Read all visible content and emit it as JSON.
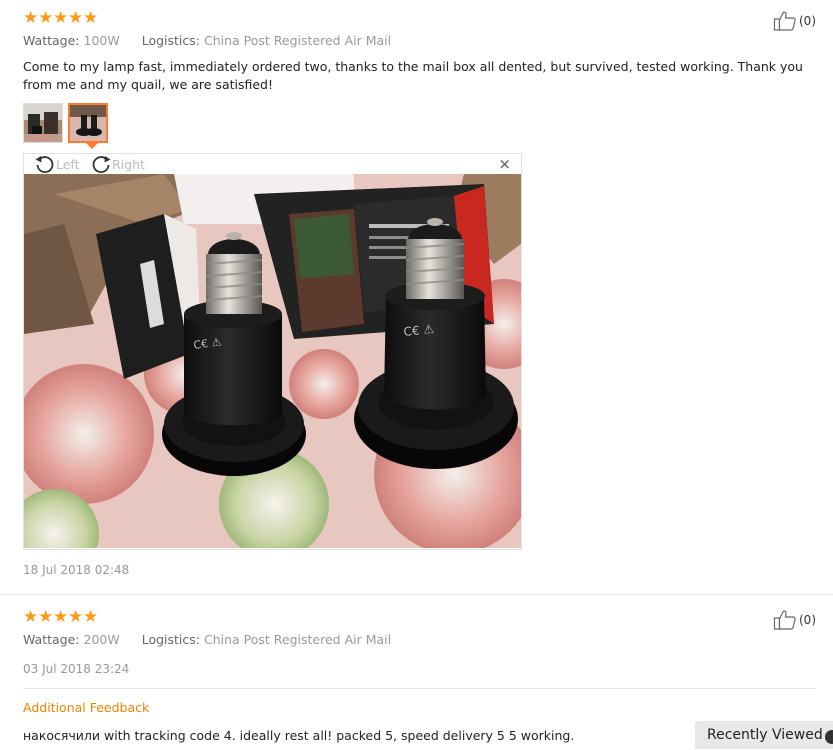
{
  "reviews": [
    {
      "rating": 5,
      "attributes": {
        "wattage_label": "Wattage:",
        "wattage_value": "100W",
        "logistics_label": "Logistics:",
        "logistics_value": "China Post Registered Air Mail"
      },
      "helpful_count": "(0)",
      "text": "Come to my lamp fast, immediately ordered two, thanks to the mail box all dented, but survived, tested working. Thank you from me and my quail, we are satisfied!",
      "thumbnail_count": 2,
      "active_thumbnail": 2,
      "viewer": {
        "rotate_left_label": "Left",
        "rotate_right_label": "Right",
        "close_symbol": "×",
        "image_description_icon": "photo-two-black-ceramic-heat-lamps"
      },
      "date": "18 Jul 2018 02:48"
    },
    {
      "rating": 5,
      "attributes": {
        "wattage_label": "Wattage:",
        "wattage_value": "200W",
        "logistics_label": "Logistics:",
        "logistics_value": "China Post Registered Air Mail"
      },
      "helpful_count": "(0)",
      "date": "03 Jul 2018 23:24",
      "additional_feedback_label": "Additional Feedback",
      "additional_feedback_text": "накосячили with tracking code 4. ideally rest all! packed 5, speed delivery 5 5 working."
    }
  ],
  "recently_viewed_label": "Recently Viewed",
  "colors": {
    "star": "#ff9a18",
    "accent": "#f08200",
    "muted_text": "#999999",
    "active_thumb_border": "#ff7a2e"
  }
}
